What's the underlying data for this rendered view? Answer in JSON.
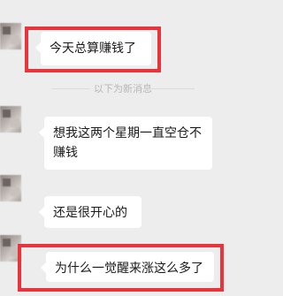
{
  "colors": {
    "background": "#ededed",
    "bubble": "#ffffff",
    "highlight": "#e8343a",
    "divider_text": "#b7b7b7"
  },
  "messages": [
    {
      "text": "今天总算赚钱了",
      "highlighted": true
    },
    {
      "text": "想我这两个星期一直空仓不赚钱",
      "highlighted": false
    },
    {
      "text": "还是很开心的",
      "highlighted": false
    },
    {
      "text": "为什么一觉醒来涨这么多了",
      "highlighted": true
    }
  ],
  "divider": {
    "label": "以下为新消息"
  }
}
